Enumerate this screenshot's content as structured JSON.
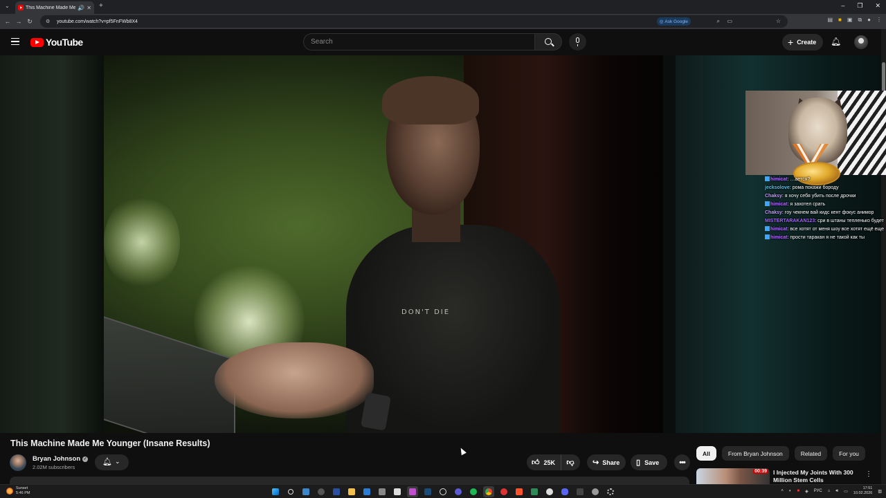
{
  "browser": {
    "tab_title": "This Machine Made Me Yo...",
    "url": "youtube.com/watch?v=pf5FnFWb8X4",
    "ask_google_label": "Ask Google",
    "window_controls": [
      "–",
      "❐",
      "✕"
    ]
  },
  "header": {
    "logo_text": "YouTube",
    "search_placeholder": "Search",
    "create_label": "Create"
  },
  "stream_overlay": {
    "chat": [
      {
        "user": "himicat",
        "color": "#b06cff",
        "badge": true,
        "text": "…ается?"
      },
      {
        "user": "jecksolove",
        "color": "#4fc3f7",
        "badge": false,
        "text": "рома покажи бороду"
      },
      {
        "user": "Chaksy",
        "color": "#c39bff",
        "badge": false,
        "text": "я хочу себя убить после дрочки"
      },
      {
        "user": "himicat",
        "color": "#b06cff",
        "badge": true,
        "text": "я захотел срать"
      },
      {
        "user": "Chaksy",
        "color": "#c39bff",
        "badge": false,
        "text": "гоу чекнем вай кидс кент фокус анимор"
      },
      {
        "user": "MISTERTARAKAN123",
        "color": "#a463ff",
        "badge": false,
        "text": "сри в штаны тепленько будет"
      },
      {
        "user": "himicat",
        "color": "#b06cff",
        "badge": true,
        "text": "все хотят от меня шоу все хотят ещё еще"
      },
      {
        "user": "himicat",
        "color": "#b06cff",
        "badge": true,
        "text": "прости таракан я не такой как ты"
      }
    ]
  },
  "video": {
    "shirt_text": "DON'T DIE",
    "title": "This Machine Made Me Younger (Insane Results)",
    "channel_name": "Bryan Johnson",
    "subscribers": "2.02M subscribers",
    "likes": "25K",
    "share_label": "Share",
    "save_label": "Save"
  },
  "sidebar": {
    "chips": [
      "All",
      "From Bryan Johnson",
      "Related",
      "For you"
    ],
    "active_chip": "All",
    "recommendation": {
      "title": "I Injected My Joints With 300 Million Stem Cells",
      "duration": "00:39"
    }
  },
  "taskbar": {
    "weather_label": "Sunset",
    "weather_time": "5:46 PM",
    "language": "РУС",
    "time": "17:51",
    "date": "10.02.2026"
  },
  "colors": {
    "background": "#0f0f0f",
    "youtube_red": "#ff0000",
    "chip_bg": "#272727",
    "text_secondary": "#aaaaaa"
  }
}
